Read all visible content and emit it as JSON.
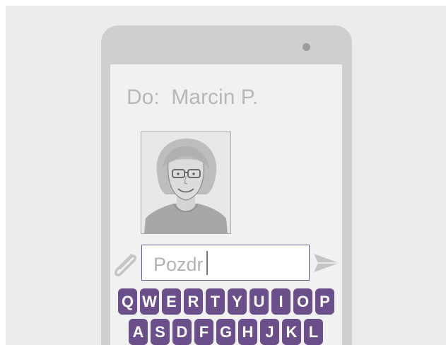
{
  "message": {
    "recipient_label": "Do:",
    "recipient_name": "Marcin P.",
    "input_text": "Pozdr"
  },
  "keyboard": {
    "row1": [
      "Q",
      "W",
      "E",
      "R",
      "T",
      "Y",
      "U",
      "I",
      "O",
      "P"
    ],
    "row2": [
      "A",
      "S",
      "D",
      "F",
      "G",
      "H",
      "J",
      "K",
      "L"
    ]
  },
  "icons": {
    "attach": "paperclip-icon",
    "send": "send-icon",
    "contact_photo": "contact-photo"
  },
  "colors": {
    "key_background": "#6a4f8a",
    "input_border": "#6f5a8e",
    "text_gray": "#b7b7b9"
  }
}
